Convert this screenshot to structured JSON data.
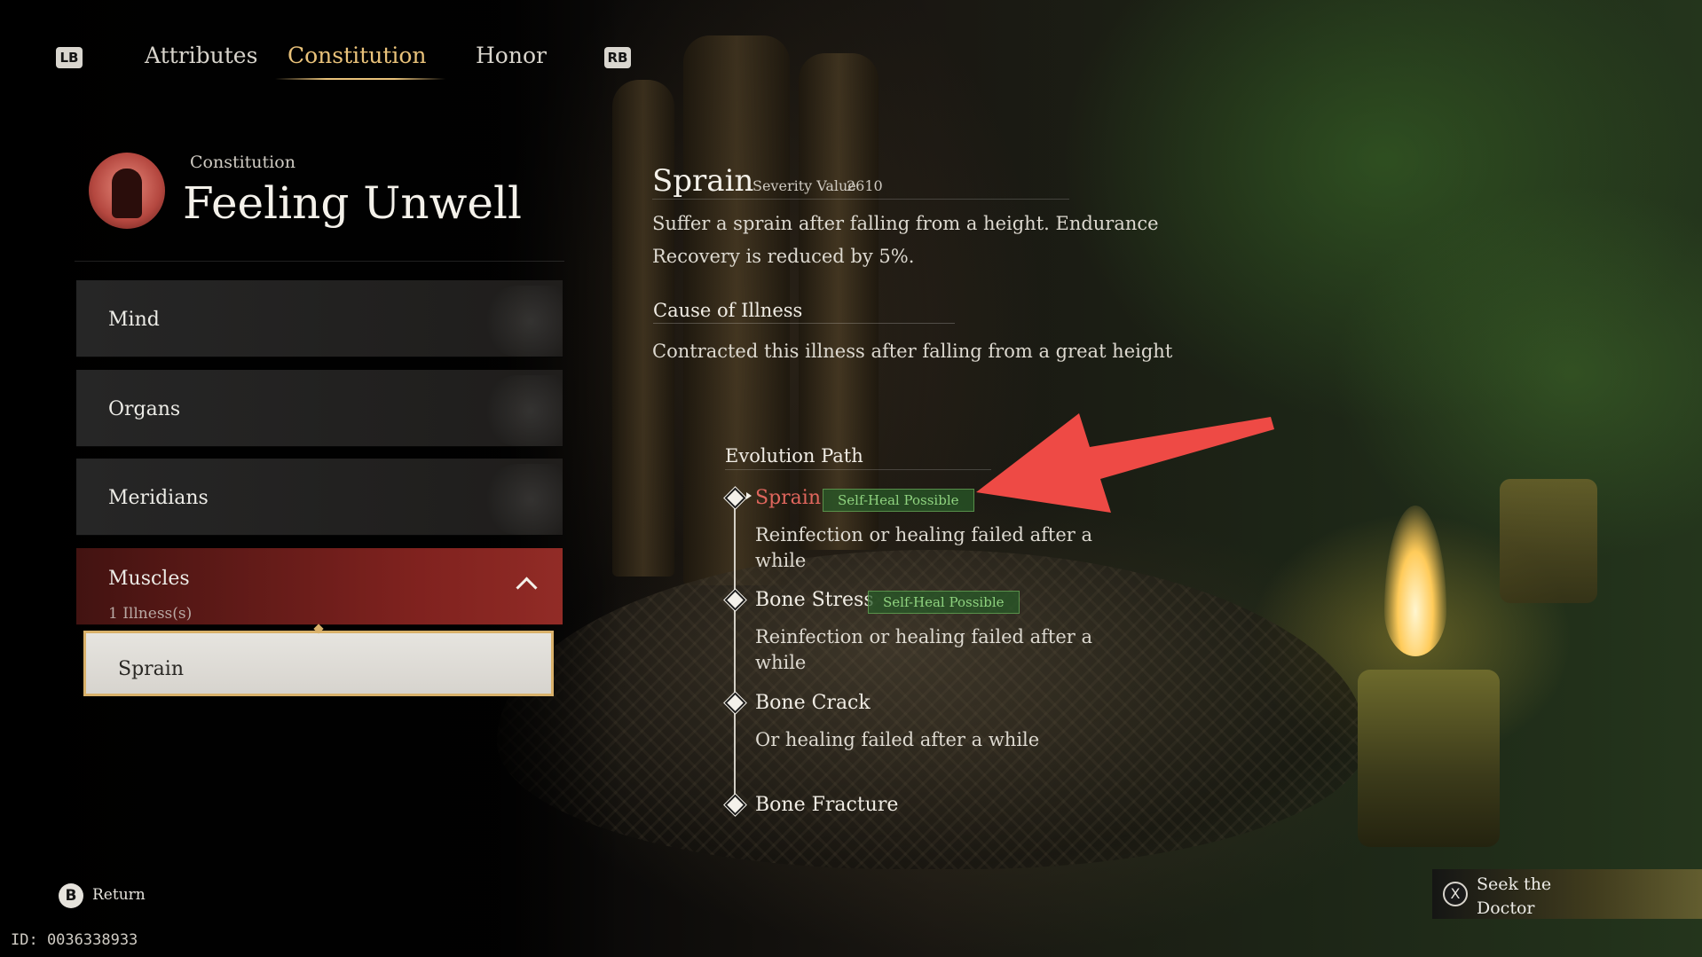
{
  "tabs": {
    "left_key": "LB",
    "right_key": "RB",
    "items": [
      {
        "label": "Attributes",
        "active": false
      },
      {
        "label": "Constitution",
        "active": true
      },
      {
        "label": "Honor",
        "active": false
      }
    ]
  },
  "header": {
    "subtitle": "Constitution",
    "title": "Feeling Unwell",
    "icon": "figure-portrait-icon"
  },
  "categories": [
    {
      "label": "Mind",
      "icon": "mind-emblem-icon"
    },
    {
      "label": "Organs",
      "icon": "organs-emblem-icon"
    },
    {
      "label": "Meridians",
      "icon": "meridians-emblem-icon"
    },
    {
      "label": "Muscles",
      "count": "1 Illness(s)",
      "expanded": true,
      "icon": "chevron-up-icon"
    }
  ],
  "selected_illness": "Sprain",
  "detail": {
    "title": "Sprain",
    "severity_label": "Severity Value",
    "severity_value": "2610",
    "description": "Suffer a sprain after falling from a height. Endurance Recovery is reduced by 5%.",
    "cause_heading": "Cause of Illness",
    "cause": "Contracted this illness after falling from a great height"
  },
  "evolution": {
    "heading": "Evolution Path",
    "stages": [
      {
        "name": "Sprain",
        "badge": "Self-Heal Possible",
        "current": true,
        "desc": "Reinfection or healing failed after a while"
      },
      {
        "name": "Bone Stress",
        "badge": "Self-Heal Possible",
        "current": false,
        "desc": "Reinfection or healing failed after a while"
      },
      {
        "name": "Bone Crack",
        "badge": "",
        "current": false,
        "desc": "Or healing failed after a while"
      },
      {
        "name": "Bone Fracture",
        "badge": "",
        "current": false,
        "desc": ""
      }
    ]
  },
  "footer": {
    "return_key": "B",
    "return_label": "Return",
    "id_text": "ID: 0036338933",
    "seek_key": "X",
    "seek_label": "Seek the Doctor"
  },
  "colors": {
    "accent_gold": "#e9c27a",
    "illness_red": "#e0665d",
    "badge_green": "#8fd37f",
    "annotation_arrow": "#ee4a45"
  }
}
